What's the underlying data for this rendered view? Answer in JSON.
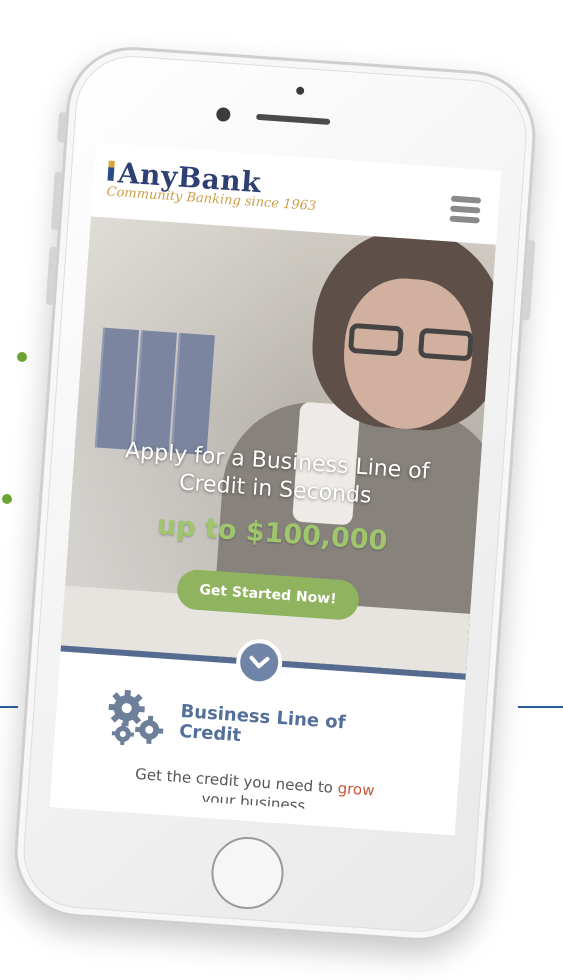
{
  "brand": {
    "name": "AnyBank",
    "tagline": "Community Banking since 1963"
  },
  "hero": {
    "title_line1": "Apply for a Business Line of",
    "title_line2": "Credit in Seconds",
    "amount": "up to $100,000",
    "cta_label": "Get Started Now!"
  },
  "product": {
    "title_line1": "Business Line of",
    "title_line2": "Credit",
    "desc_prefix": "Get the credit you need to ",
    "desc_accent": "grow",
    "desc_line2": "your business"
  },
  "icons": {
    "menu": "hamburger-menu-icon",
    "scroll": "chevron-down-icon",
    "product": "gears-icon"
  },
  "colors": {
    "brand_navy": "#2d3f73",
    "brand_gold": "#c9a14a",
    "cta_green": "#8fb35e",
    "amount_green": "#9fc56d",
    "product_blue": "#54709a",
    "accent_orange": "#c9553a",
    "deco_blue": "#1f5aa6",
    "deco_green": "#6da535"
  }
}
